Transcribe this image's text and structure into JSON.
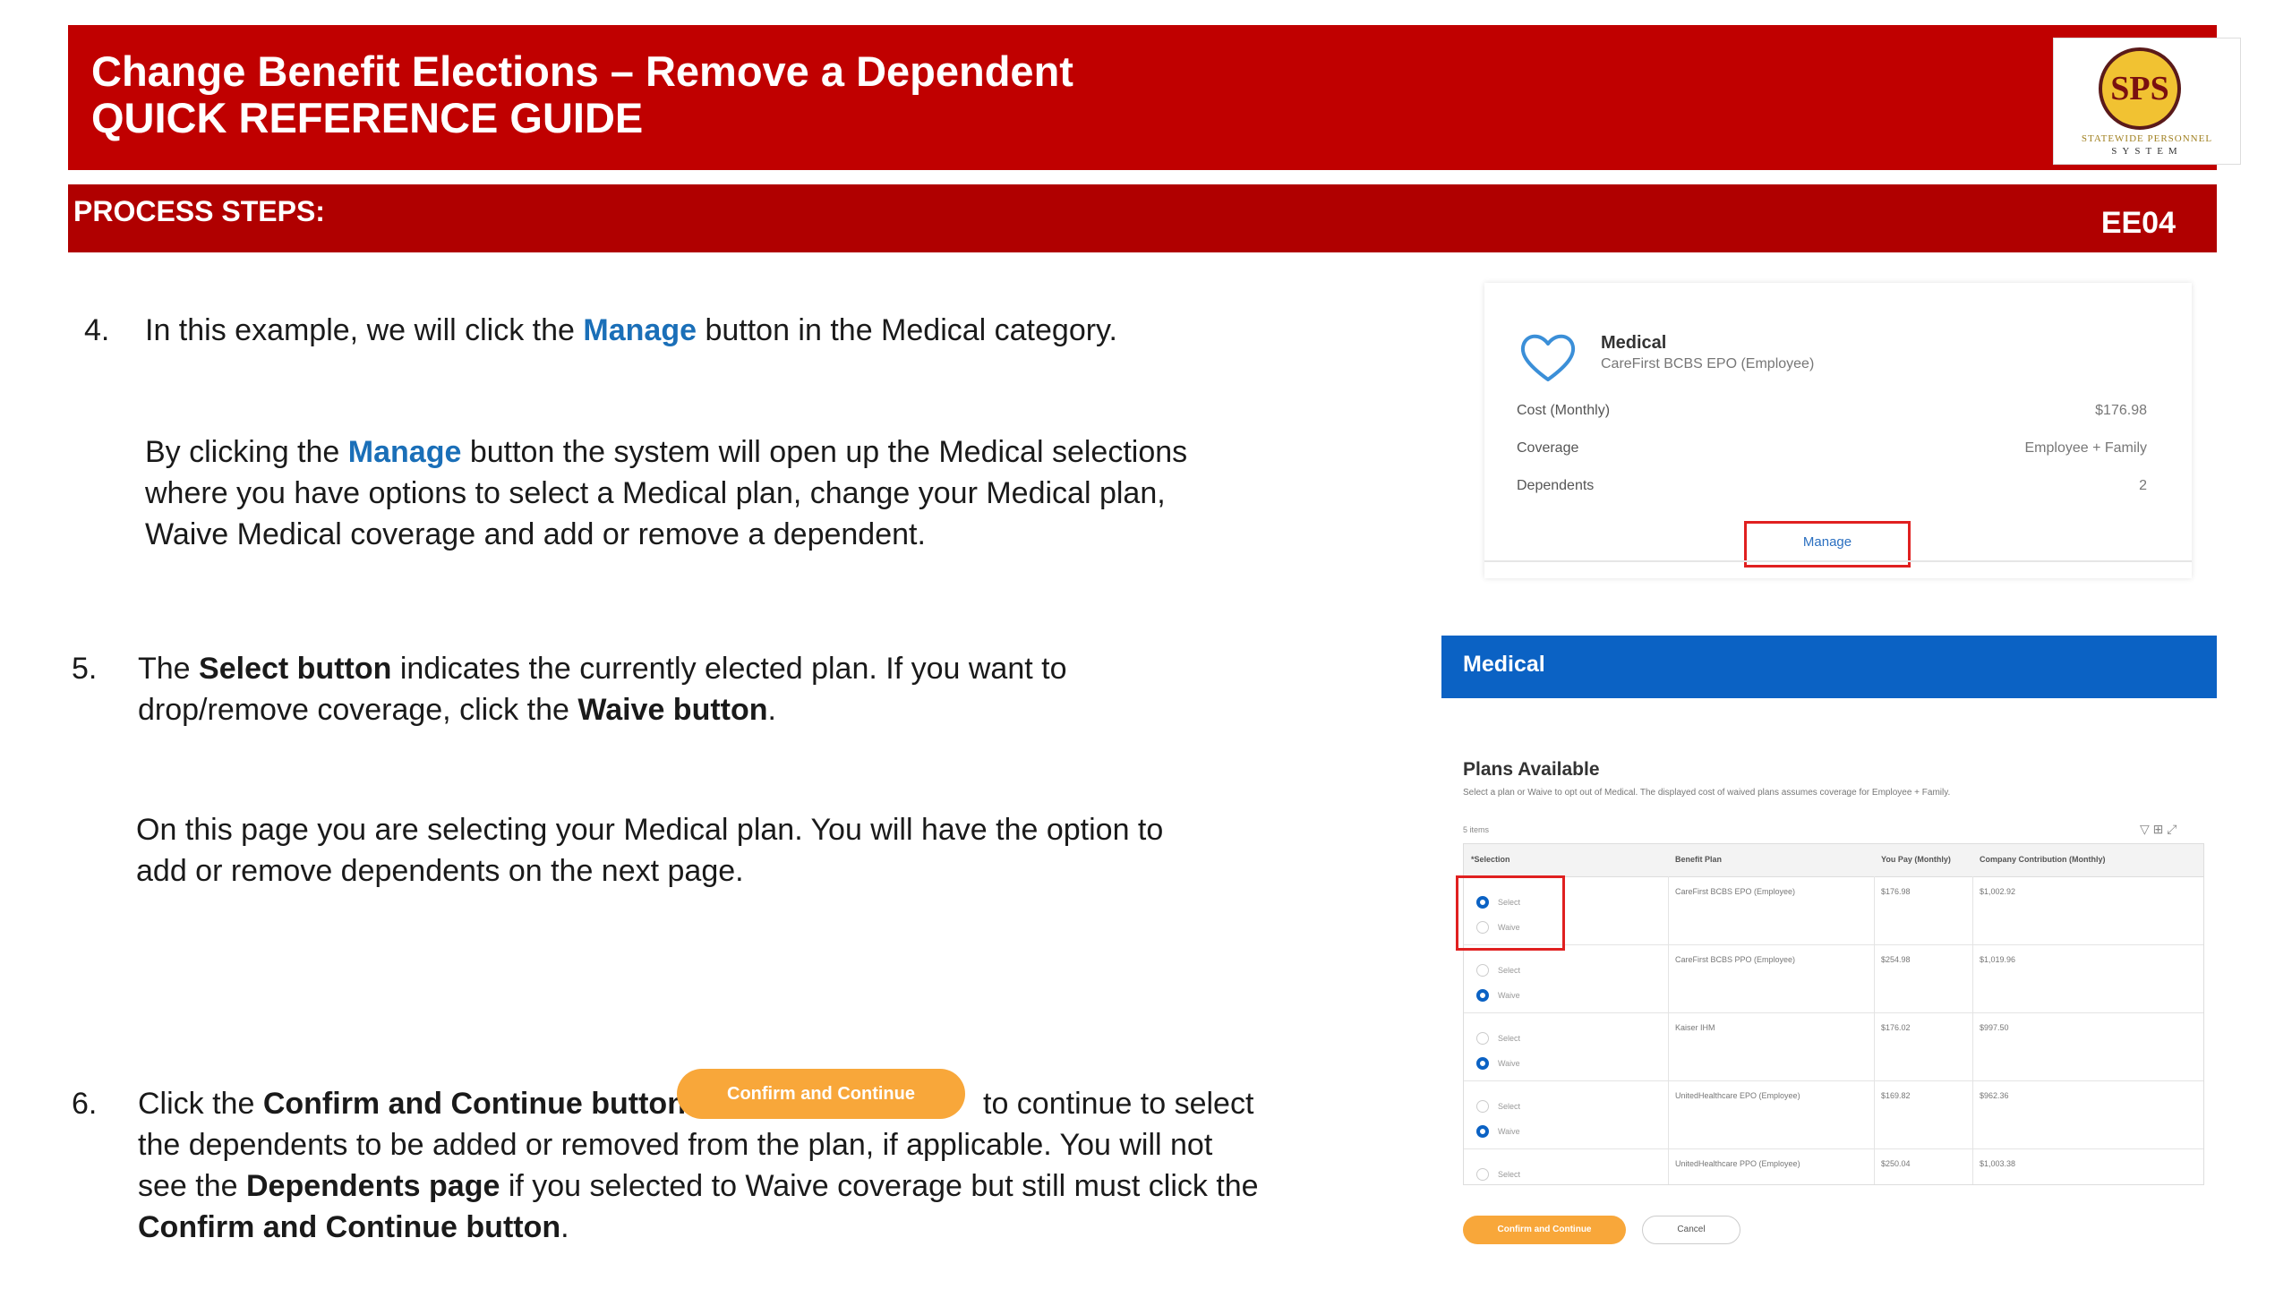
{
  "header": {
    "title_line1": "Change Benefit Elections – Remove a Dependent",
    "title_line2": "QUICK REFERENCE GUIDE",
    "logo_initials": "SPS",
    "logo_text": "STATEWIDE PERSONNEL",
    "logo_text2": "SYSTEM"
  },
  "steps_bar": {
    "label": "PROCESS STEPS:",
    "code": "EE04"
  },
  "step4": {
    "number": "4.",
    "pre": "In this example, we will click the",
    "manage": "Manage",
    "post": "button in the Medical category.",
    "para_pre": "By clicking the",
    "para_manage": "Manage",
    "para_post": "button the system will open up the Medical selections",
    "para_line2": "where you have options to select a Medical plan, change your Medical plan,",
    "para_line3": "Waive Medical coverage and add or remove a dependent."
  },
  "step5": {
    "number": "5.",
    "pre": "The",
    "select_btn": "Select button",
    "mid": "indicates the currently elected plan.  If you want to",
    "line2_pre": "drop/remove coverage, click the",
    "waive_btn": "Waive button",
    "line2_post": ".",
    "para_line1": "On this page you are selecting your Medical plan.  You will have the option to",
    "para_line2": "add or remove dependents on the next page."
  },
  "step6": {
    "number": "6.",
    "pre": "Click the",
    "confirm_btn": "Confirm and Continue button",
    "inline_button": "Confirm and Continue",
    "post": "to continue to select",
    "line2": "the dependents to be added or removed from the plan, if applicable. You will not",
    "line3_pre": "see the",
    "dependents_page": "Dependents page",
    "line3_post": "if you selected to Waive coverage but still must click the",
    "line4_bold": "Confirm and Continue button",
    "line4_post": "."
  },
  "medical_card": {
    "title": "Medical",
    "subtitle": "CareFirst BCBS EPO (Employee)",
    "rows": [
      {
        "label": "Cost (Monthly)",
        "value": "$176.98"
      },
      {
        "label": "Coverage",
        "value": "Employee + Family"
      },
      {
        "label": "Dependents",
        "value": "2"
      }
    ],
    "manage_link": "Manage",
    "icon": "heart-icon"
  },
  "medical_panel": {
    "header": "Medical",
    "plans_title": "Plans Available",
    "description": "Select a plan or Waive to opt out of Medical. The displayed cost of waived plans assumes coverage for Employee + Family.",
    "items_count": "5 items",
    "columns": [
      "*Selection",
      "Benefit Plan",
      "You Pay (Monthly)",
      "Company Contribution (Monthly)"
    ],
    "select_label": "Select",
    "waive_label": "Waive",
    "rows": [
      {
        "plan": "CareFirst BCBS EPO (Employee)",
        "you_pay": "$176.98",
        "company": "$1,002.92",
        "selected": "Select"
      },
      {
        "plan": "CareFirst BCBS PPO (Employee)",
        "you_pay": "$254.98",
        "company": "$1,019.96",
        "selected": "Waive"
      },
      {
        "plan": "Kaiser IHM",
        "you_pay": "$176.02",
        "company": "$997.50",
        "selected": "Waive"
      },
      {
        "plan": "UnitedHealthcare EPO (Employee)",
        "you_pay": "$169.82",
        "company": "$962.36",
        "selected": "Waive"
      },
      {
        "plan": "UnitedHealthcare PPO (Employee)",
        "you_pay": "$250.04",
        "company": "$1,003.38",
        "selected": ""
      }
    ],
    "confirm_button": "Confirm and Continue",
    "cancel_button": "Cancel"
  },
  "colors": {
    "banner_red": "#c00000",
    "steps_red": "#b00000",
    "link_blue": "#1a6fb8",
    "workday_blue": "#0b62c4",
    "orange_button": "#f8a73a",
    "highlight_red": "#e02020"
  }
}
